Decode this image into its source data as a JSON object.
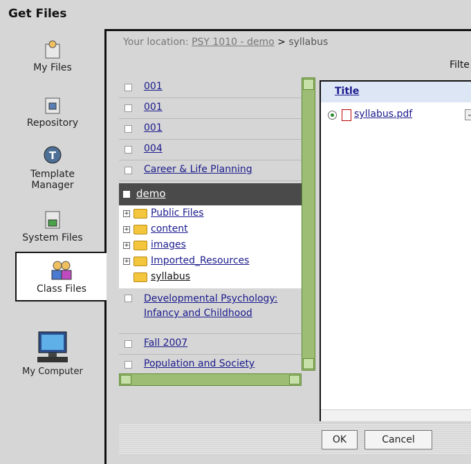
{
  "window": {
    "title": "Get Files"
  },
  "sidebar": {
    "items": [
      {
        "label": "My Files"
      },
      {
        "label": "Repository"
      },
      {
        "label": "Template Manager"
      },
      {
        "label": "System Files"
      },
      {
        "label": "Class Files"
      },
      {
        "label": "My Computer"
      }
    ]
  },
  "location": {
    "prefix": "Your location:",
    "course": "PSY 1010 - demo",
    "separator": ">",
    "current": "syllabus"
  },
  "filter_label": "Filte",
  "tree": {
    "items_top": [
      "001",
      "001",
      "001",
      "004",
      "Career & Life Planning"
    ],
    "selected": "demo",
    "subitems": [
      "Public Files",
      "content",
      "images",
      "Imported_Resources",
      "syllabus"
    ],
    "items_bottom": [
      "Developmental Psychology: Infancy and Childhood",
      "Fall 2007",
      "Population and Society"
    ]
  },
  "files": {
    "column_title": "Title",
    "rows": [
      {
        "name": "syllabus.pdf",
        "selected": true
      }
    ]
  },
  "buttons": {
    "ok": "OK",
    "cancel": "Cancel"
  }
}
